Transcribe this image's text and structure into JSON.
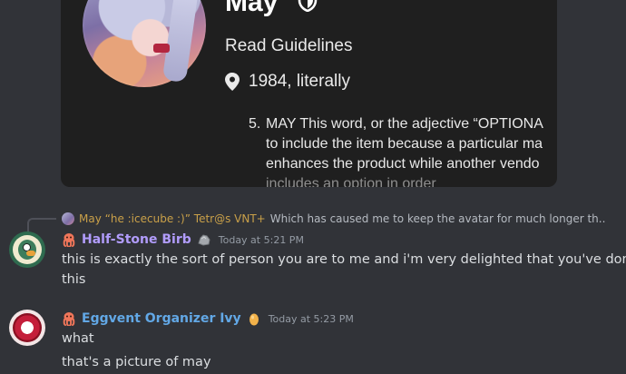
{
  "embed": {
    "profile_name": "May",
    "guidelines": "Read Guidelines",
    "location": "1984, literally",
    "list_number": "5.",
    "spec_lines": [
      "MAY This word, or the adjective “OPTIONA",
      "to include the item because a particular ma",
      "enhances the product while another vendo",
      "includes an option in order"
    ]
  },
  "reply": {
    "author": "May “he :icecube :)” Tetr@s VNT+",
    "text": "Which has caused me to keep the avatar for much longer th..."
  },
  "messages": [
    {
      "author": "Half-Stone Birb",
      "author_color": "#b19cfc",
      "timestamp": "Today at 5:21 PM",
      "lines": [
        "this is exactly the sort of person you are to me and i'm very delighted that you've done",
        "this"
      ]
    },
    {
      "author": "Eggvent Organizer Ivy",
      "author_color": "#62a8e6",
      "timestamp": "Today at 5:23 PM",
      "lines": [
        "what",
        "that's a picture of may"
      ]
    }
  ],
  "icons": {
    "shield": "shield-icon",
    "pin": "location-pin-icon",
    "role": "octopus-role-icon",
    "badge_rock": "rock-badge-icon",
    "badge_egg": "egg-badge-icon"
  },
  "colors": {
    "background": "#313338",
    "embed_bg": "#1f1f1f",
    "reply_author": "#c9a049",
    "timestamp": "#949ba4",
    "body_text": "#dbdee1"
  }
}
